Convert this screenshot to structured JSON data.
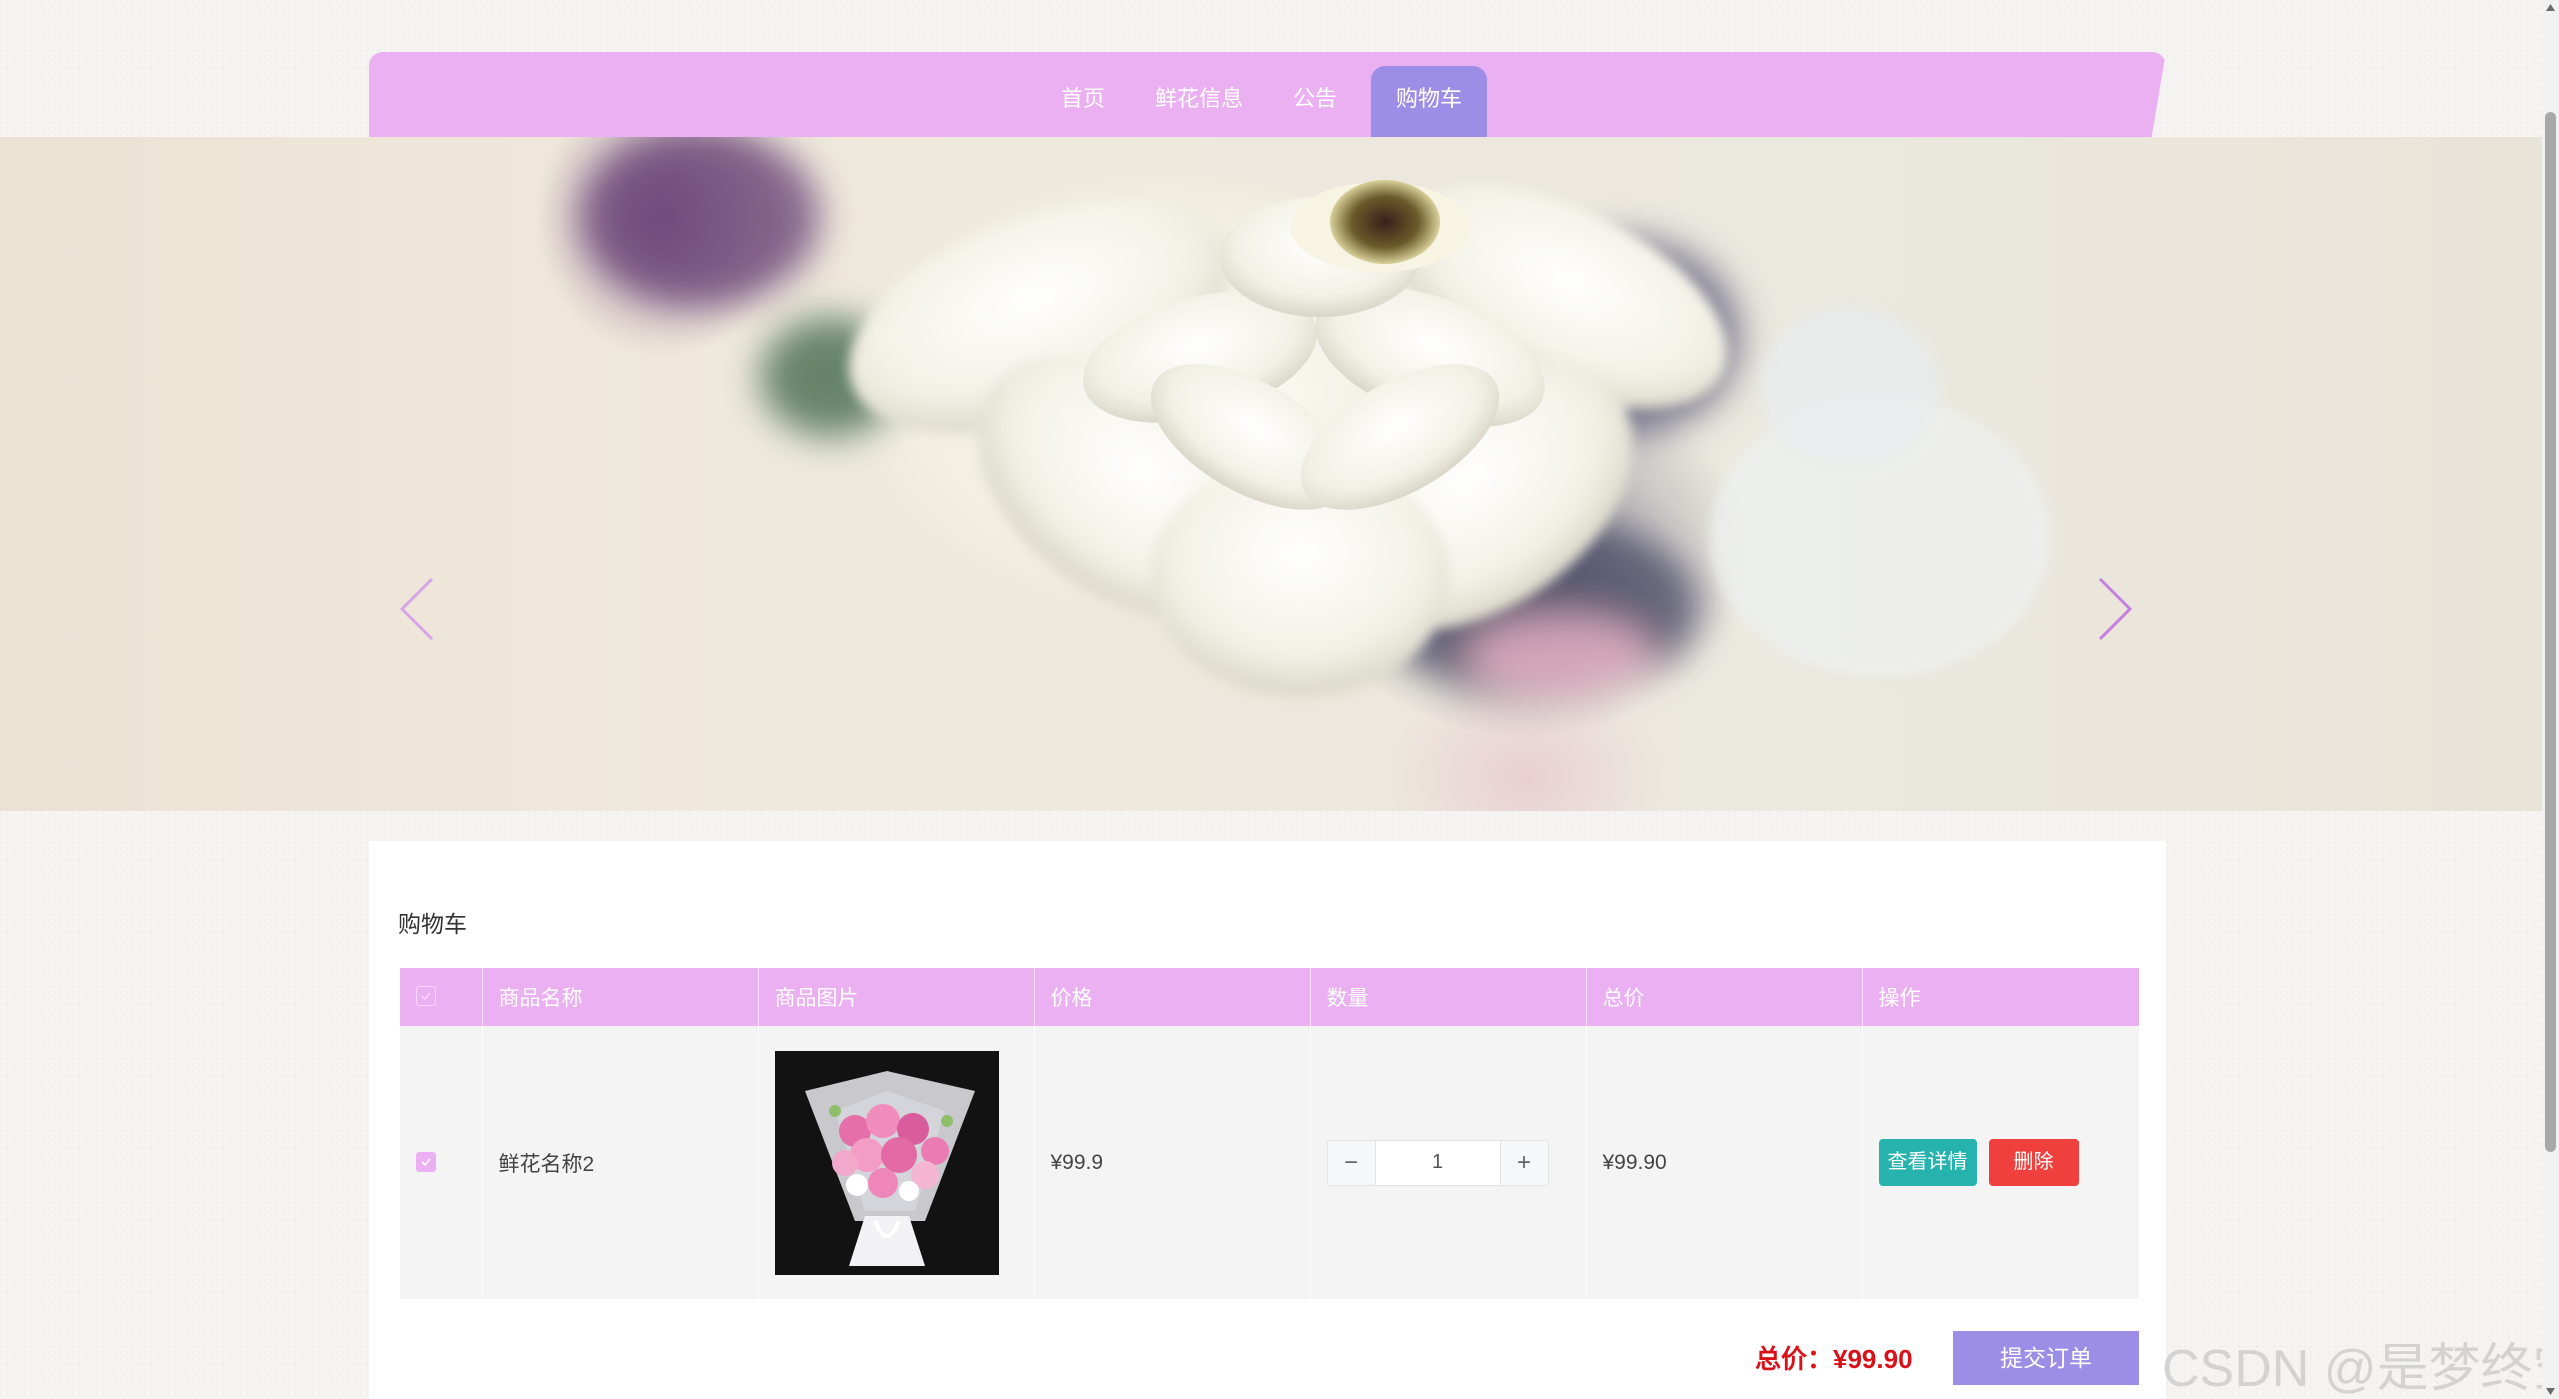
{
  "nav": {
    "items": [
      {
        "label": "首页"
      },
      {
        "label": "鲜花信息"
      },
      {
        "label": "公告"
      },
      {
        "label": "购物车",
        "active": true
      }
    ]
  },
  "banner": {
    "prev_icon": "chevron-left-icon",
    "next_icon": "chevron-right-icon"
  },
  "cart": {
    "title": "购物车",
    "columns": {
      "name": "商品名称",
      "image": "商品图片",
      "price": "价格",
      "quantity": "数量",
      "total": "总价",
      "actions": "操作"
    },
    "rows": [
      {
        "checked": true,
        "name": "鲜花名称2",
        "price": "¥99.9",
        "quantity": "1",
        "total": "¥99.90",
        "detail_label": "查看详情",
        "delete_label": "删除"
      }
    ],
    "summary": "总价：¥99.90",
    "submit_label": "提交订单"
  },
  "watermark": "CSDN @是梦终空",
  "colors": {
    "nav_bg": "#ebb0f2",
    "nav_active": "#9c8de6",
    "detail_button": "#26b3ad",
    "delete_button": "#f0403d",
    "price_red": "#d9121a",
    "submit_button": "#9c8de6"
  }
}
